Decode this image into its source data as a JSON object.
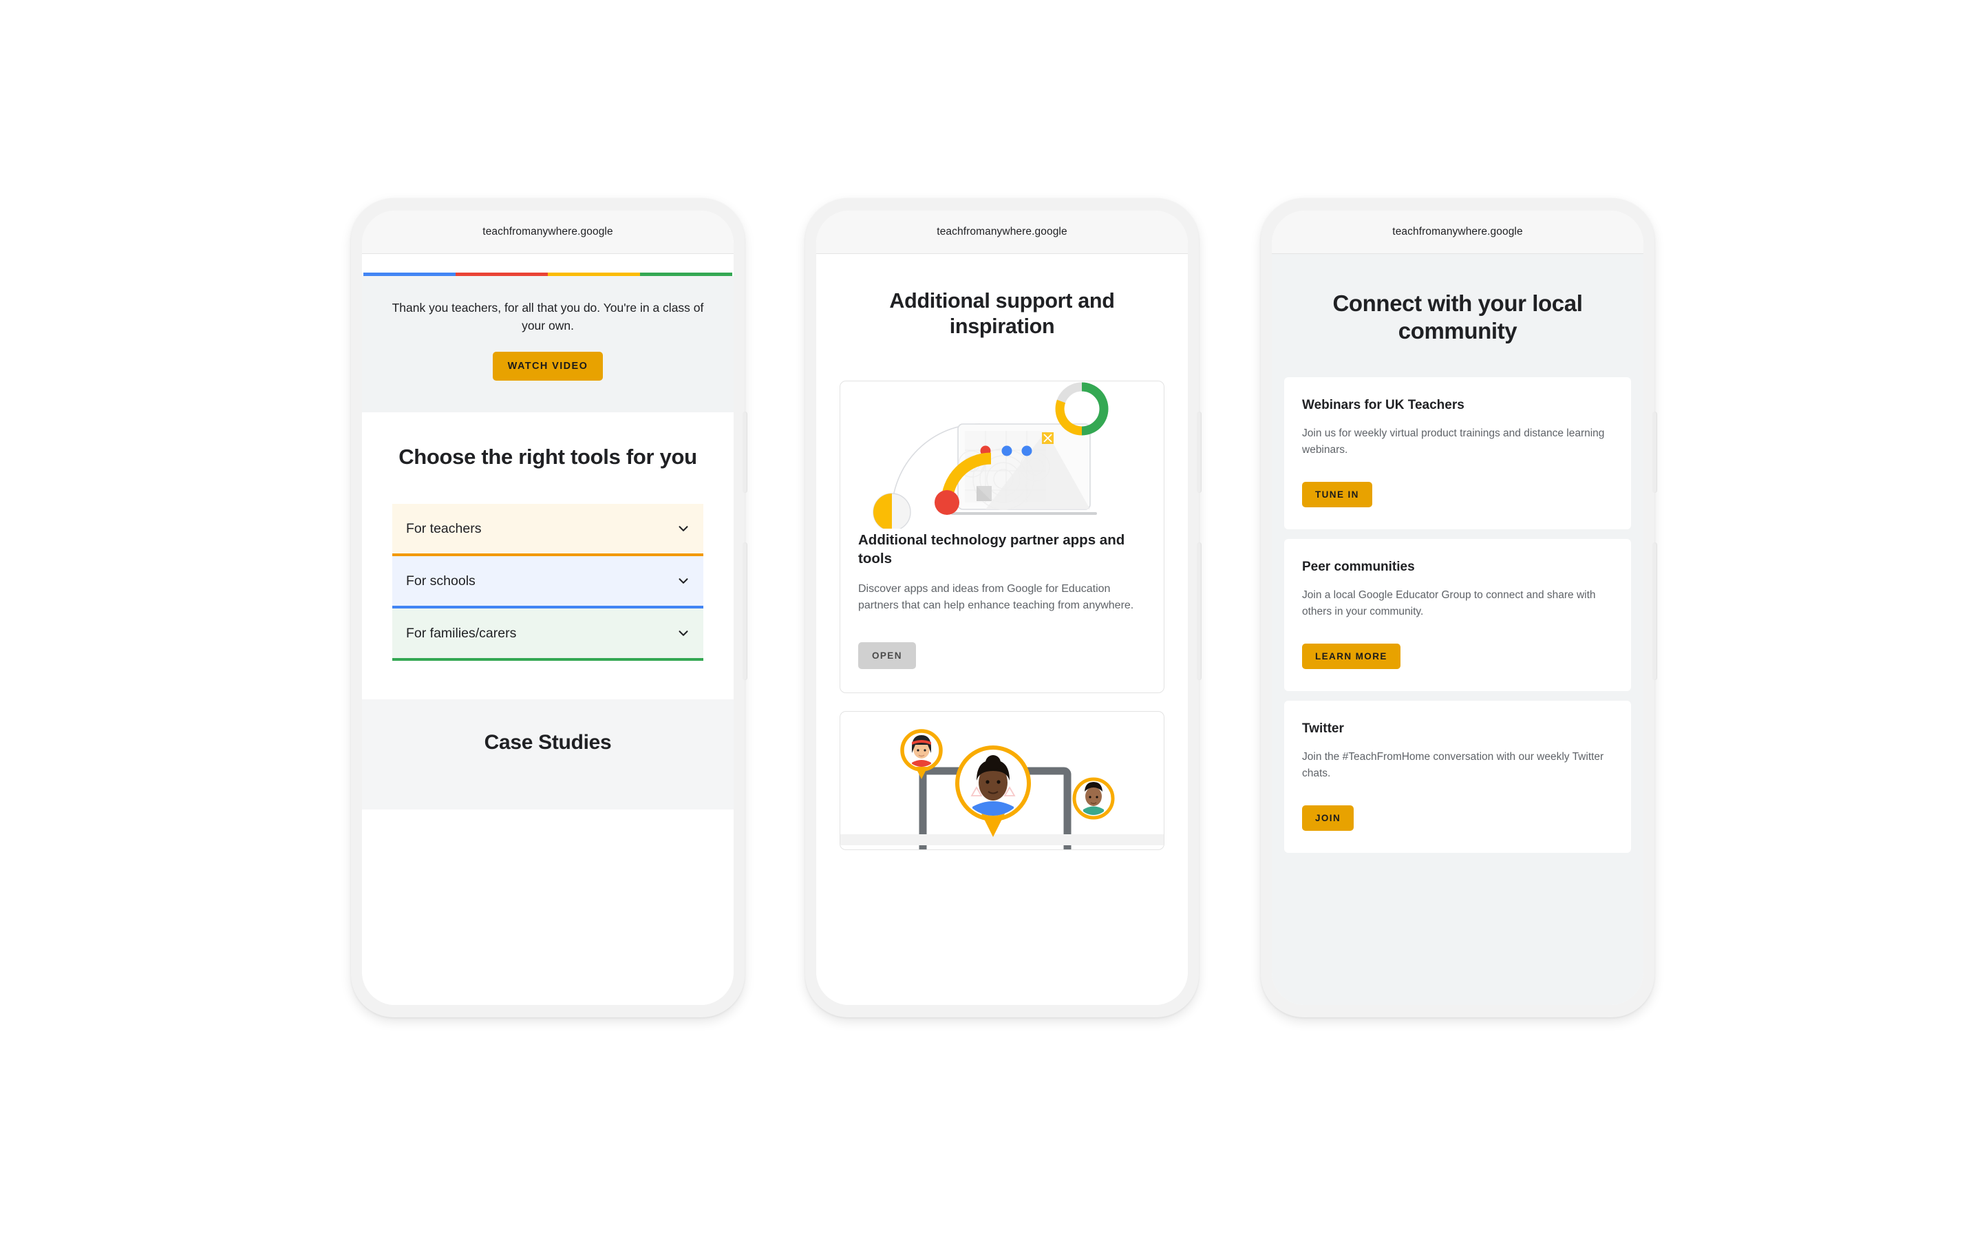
{
  "browser": {
    "url": "teachfromanywhere.google"
  },
  "colors": {
    "google_blue": "#4285F4",
    "google_red": "#EA4335",
    "google_yellow": "#FBBC04",
    "google_green": "#34A853",
    "amber_button": "#E8A200",
    "grey_button": "#D0D0D0",
    "page_grey": "#F1F3F4"
  },
  "phone1": {
    "hero": {
      "message": "Thank you teachers, for all that you do. You're in a class of your own.",
      "cta_label": "WATCH VIDEO"
    },
    "tools_section": {
      "title": "Choose the right tools for you",
      "items": [
        {
          "label": "For teachers",
          "bg": "#FEF7E8",
          "rule": "#F29900",
          "icon": "chevron-down-icon"
        },
        {
          "label": "For schools",
          "bg": "#EEF3FE",
          "rule": "#4285F4",
          "icon": "chevron-down-icon"
        },
        {
          "label": "For families/carers",
          "bg": "#EDF6EF",
          "rule": "#34A853",
          "icon": "chevron-down-icon"
        }
      ]
    },
    "case_studies": {
      "title": "Case Studies"
    }
  },
  "phone2": {
    "title": "Additional support and inspiration",
    "cards": [
      {
        "illustration": "laptop-with-google-shapes-illustration",
        "heading": "Additional technology partner apps and tools",
        "body": "Discover apps and ideas from Google for Education partners that can help enhance teaching from anywhere.",
        "cta_label": "OPEN",
        "cta_style": "grey"
      },
      {
        "illustration": "video-call-avatars-illustration",
        "heading": "",
        "body": "",
        "cta_label": "",
        "cta_style": ""
      }
    ]
  },
  "phone3": {
    "title": "Connect with your local community",
    "cards": [
      {
        "heading": "Webinars for UK Teachers",
        "body": "Join us for weekly virtual product trainings and distance learning webinars.",
        "cta_label": "TUNE IN"
      },
      {
        "heading": "Peer communities",
        "body": "Join a local Google Educator Group to connect and share with others in your community.",
        "cta_label": "LEARN MORE"
      },
      {
        "heading": "Twitter",
        "body": "Join the #TeachFromHome conversation with our weekly Twitter chats.",
        "cta_label": "JOIN"
      }
    ]
  }
}
